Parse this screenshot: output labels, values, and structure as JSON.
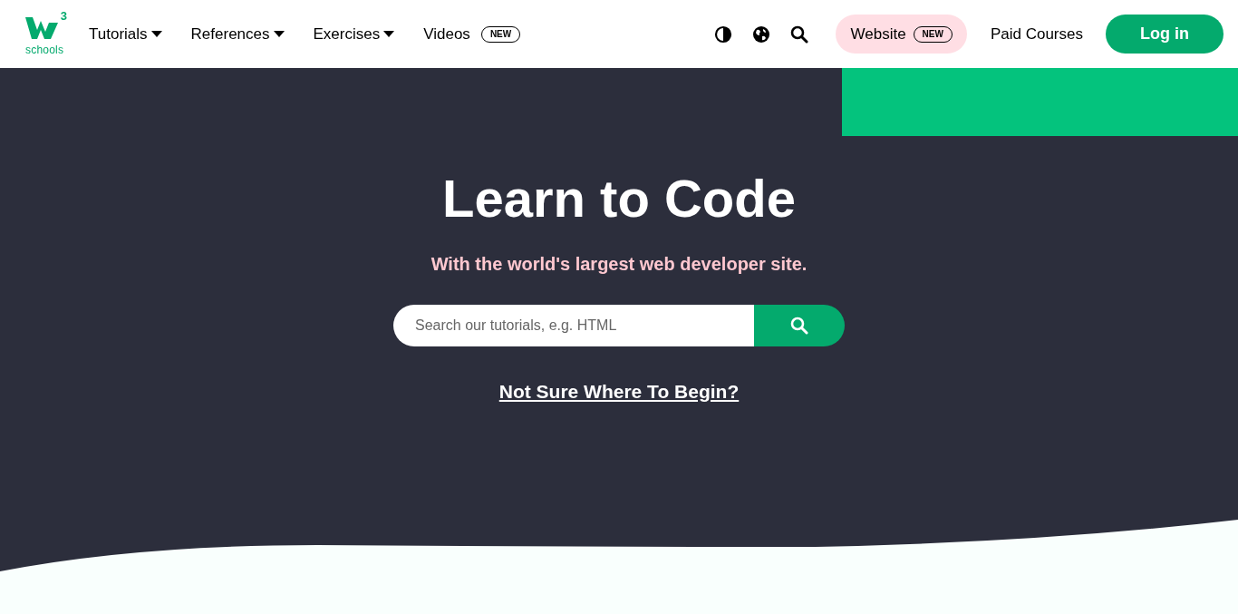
{
  "logo": {
    "superscript": "3",
    "wordmark": "schools"
  },
  "nav": [
    {
      "label": "Tutorials",
      "kind": "dropdown"
    },
    {
      "label": "References",
      "kind": "dropdown"
    },
    {
      "label": "Exercises",
      "kind": "dropdown"
    },
    {
      "label": "Videos",
      "kind": "badge",
      "badge": "NEW"
    }
  ],
  "website": {
    "label": "Website",
    "badge": "NEW"
  },
  "paid_courses": "Paid Courses",
  "login": "Log in",
  "hero": {
    "title": "Learn to Code",
    "subtitle": "With the world's largest web developer site.",
    "search": {
      "placeholder": "Search our tutorials, e.g. HTML"
    },
    "link": "Not Sure Where To Begin?"
  }
}
